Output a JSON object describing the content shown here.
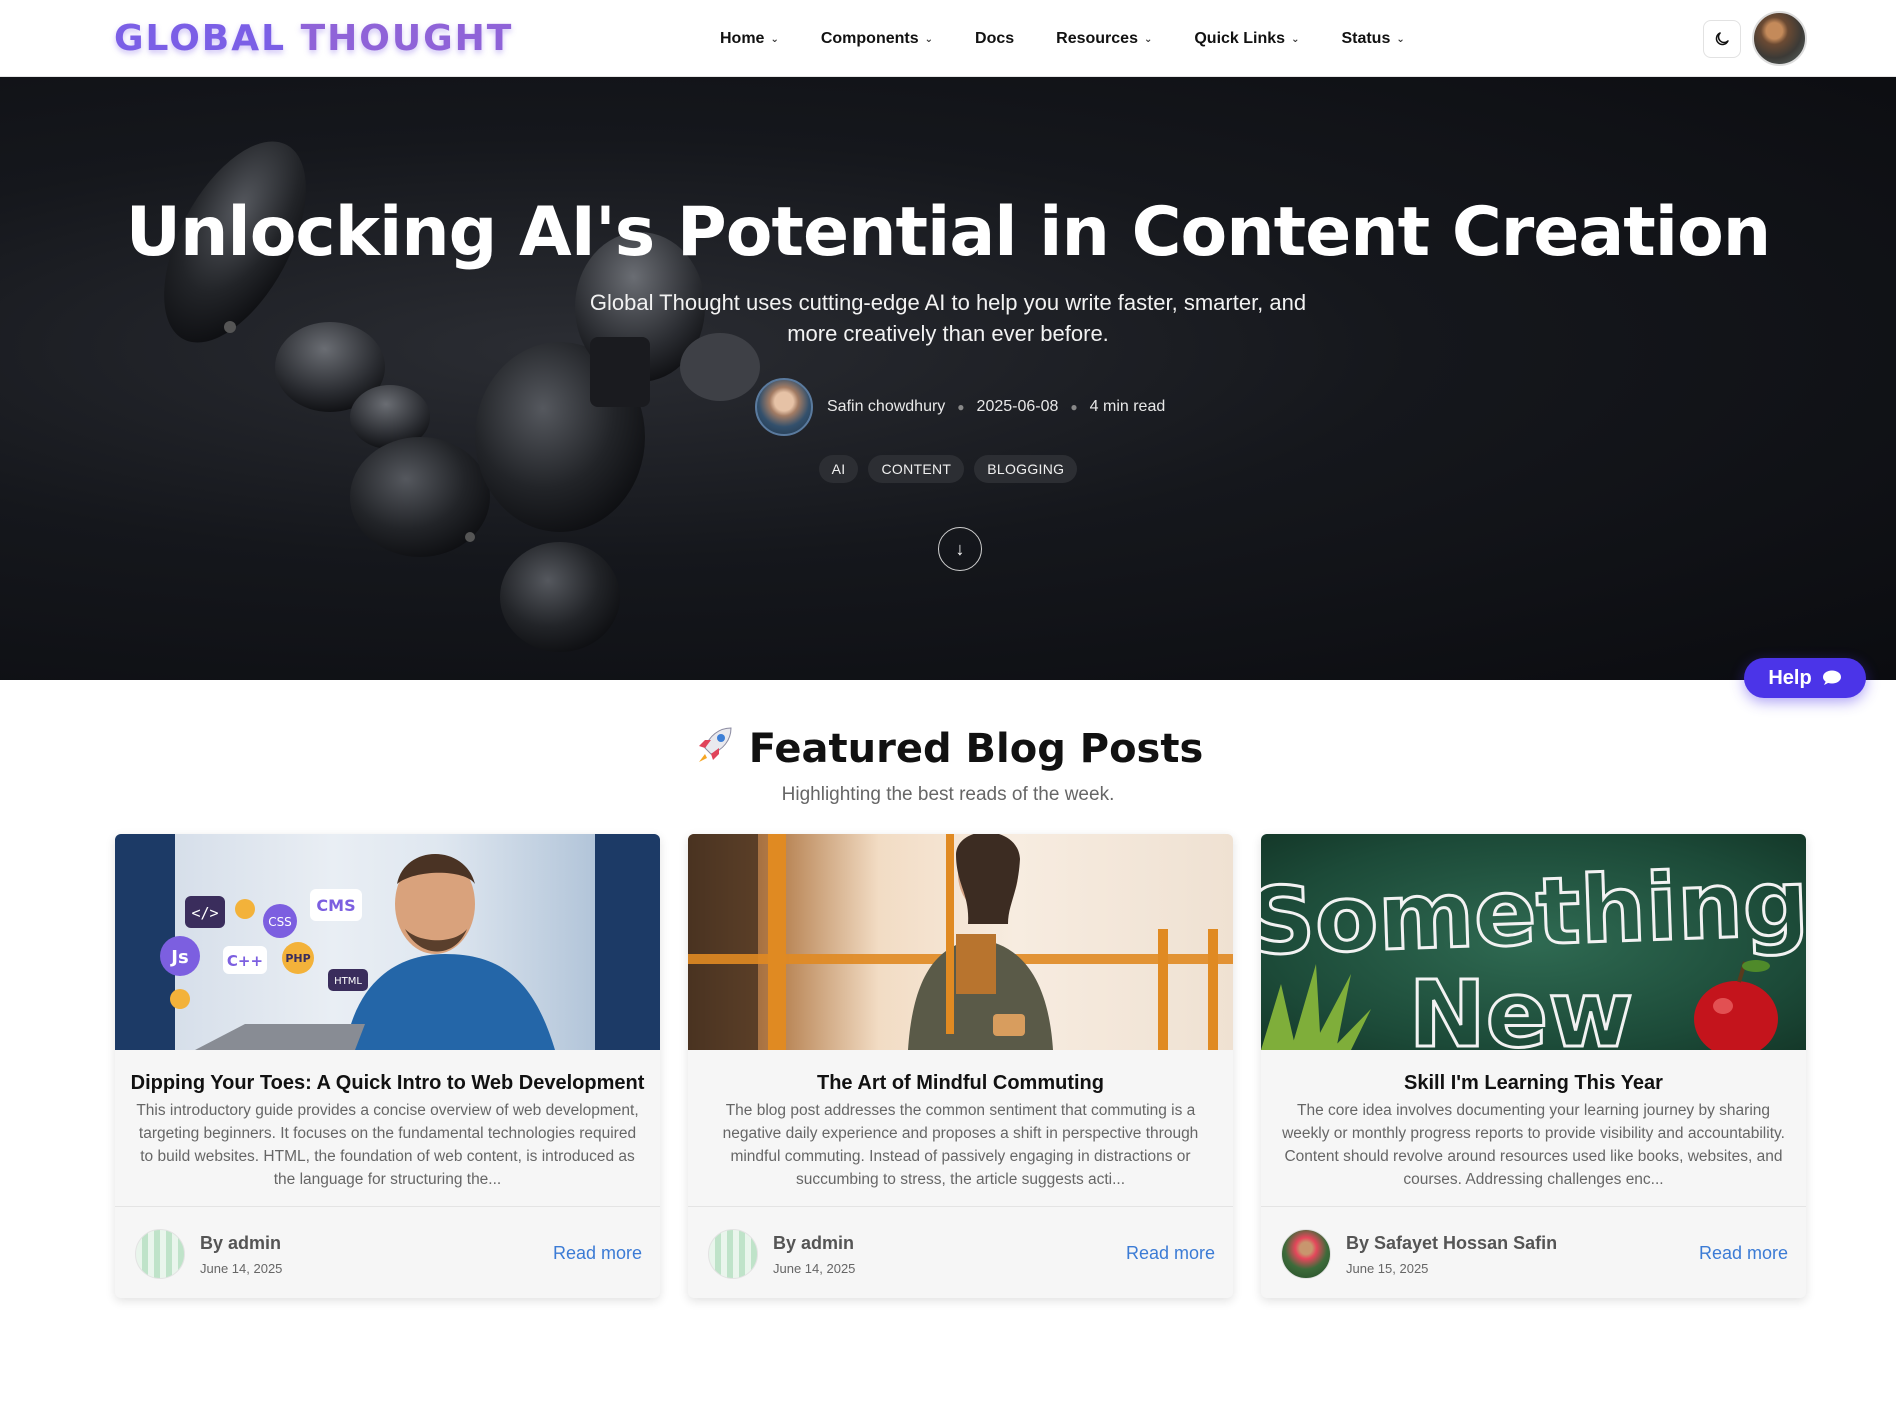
{
  "brand": {
    "word1": "GLOBAL",
    "word2": "THOUGHT"
  },
  "nav": {
    "items": [
      {
        "label": "Home",
        "dropdown": true
      },
      {
        "label": "Components",
        "dropdown": true
      },
      {
        "label": "Docs",
        "dropdown": false
      },
      {
        "label": "Resources",
        "dropdown": true
      },
      {
        "label": "Quick Links",
        "dropdown": true
      },
      {
        "label": "Status",
        "dropdown": true
      }
    ],
    "theme_icon": "moon-icon"
  },
  "hero": {
    "title": "Unlocking AI's Potential in Content Creation",
    "subtitle": "Global Thought uses cutting-edge AI to help you write faster, smarter, and more creatively than ever before.",
    "author": "Safin chowdhury",
    "date": "2025-06-08",
    "read_time": "4 min read",
    "tags": [
      "AI",
      "CONTENT",
      "BLOGGING"
    ],
    "scroll_icon": "↓"
  },
  "help": {
    "label": "Help"
  },
  "featured": {
    "title": "Featured Blog Posts",
    "subtitle": "Highlighting the best reads of the week.",
    "cards": [
      {
        "title": "Dipping Your Toes: A Quick Intro to Web Development",
        "excerpt": "This introductory guide provides a concise overview of web development, targeting beginners. It focuses on the fundamental technologies required to build websites. HTML, the foundation of web content, is introduced as the language for structuring the...",
        "author": "By admin",
        "date": "June 14, 2025",
        "read_more": "Read more",
        "image_words": [
          "</>",
          "CSS",
          "CMS",
          "Js",
          "C++",
          "PHP",
          "HTML"
        ]
      },
      {
        "title": "The Art of Mindful Commuting",
        "excerpt": "The blog post addresses the common sentiment that commuting is a negative daily experience and proposes a shift in perspective through mindful commuting. Instead of passively engaging in distractions or succumbing to stress, the article suggests acti...",
        "author": "By admin",
        "date": "June 14, 2025",
        "read_more": "Read more"
      },
      {
        "title": "Skill I'm Learning This Year",
        "excerpt": "The core idea involves documenting your learning journey by sharing weekly or monthly progress reports to provide visibility and accountability. Content should revolve around resources used like books, websites, and courses. Addressing challenges enc...",
        "author": "By Safayet Hossan Safin",
        "date": "June 15, 2025",
        "read_more": "Read more",
        "image_words": [
          "Something",
          "New"
        ]
      }
    ]
  }
}
